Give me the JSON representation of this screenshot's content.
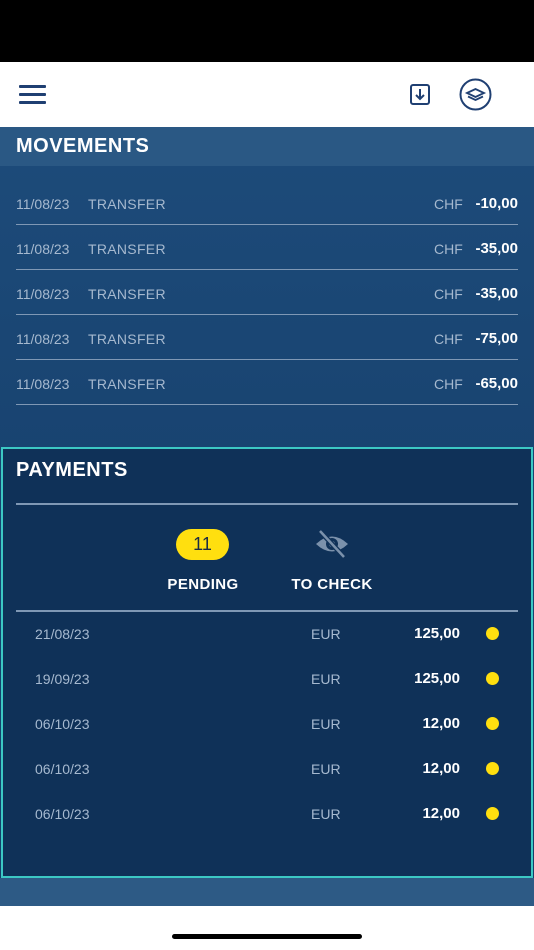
{
  "header": {
    "menu_icon": "hamburger-menu-icon",
    "download_icon": "download-icon",
    "help_icon": "lifebuoy-icon",
    "brand_color": "#1f3f72"
  },
  "movements": {
    "title": "MOVEMENTS",
    "rows": [
      {
        "date": "11/08/23",
        "description": "TRANSFER",
        "currency": "CHF",
        "amount": "-10,00"
      },
      {
        "date": "11/08/23",
        "description": "TRANSFER",
        "currency": "CHF",
        "amount": "-35,00"
      },
      {
        "date": "11/08/23",
        "description": "TRANSFER",
        "currency": "CHF",
        "amount": "-35,00"
      },
      {
        "date": "11/08/23",
        "description": "TRANSFER",
        "currency": "CHF",
        "amount": "-75,00"
      },
      {
        "date": "11/08/23",
        "description": "TRANSFER",
        "currency": "CHF",
        "amount": "-65,00"
      }
    ]
  },
  "payments": {
    "title": "PAYMENTS",
    "tabs": {
      "pending": {
        "count": "11",
        "label": "PENDING"
      },
      "to_check": {
        "label": "TO CHECK",
        "icon": "eye-slash-icon"
      }
    },
    "rows": [
      {
        "date": "21/08/23",
        "currency": "EUR",
        "amount": "125,00",
        "status": "pending"
      },
      {
        "date": "19/09/23",
        "currency": "EUR",
        "amount": "125,00",
        "status": "pending"
      },
      {
        "date": "06/10/23",
        "currency": "EUR",
        "amount": "12,00",
        "status": "pending"
      },
      {
        "date": "06/10/23",
        "currency": "EUR",
        "amount": "12,00",
        "status": "pending"
      },
      {
        "date": "06/10/23",
        "currency": "EUR",
        "amount": "12,00",
        "status": "pending"
      }
    ],
    "highlight_color": "#3cc8c4",
    "status_color": "#ffdf0f"
  }
}
